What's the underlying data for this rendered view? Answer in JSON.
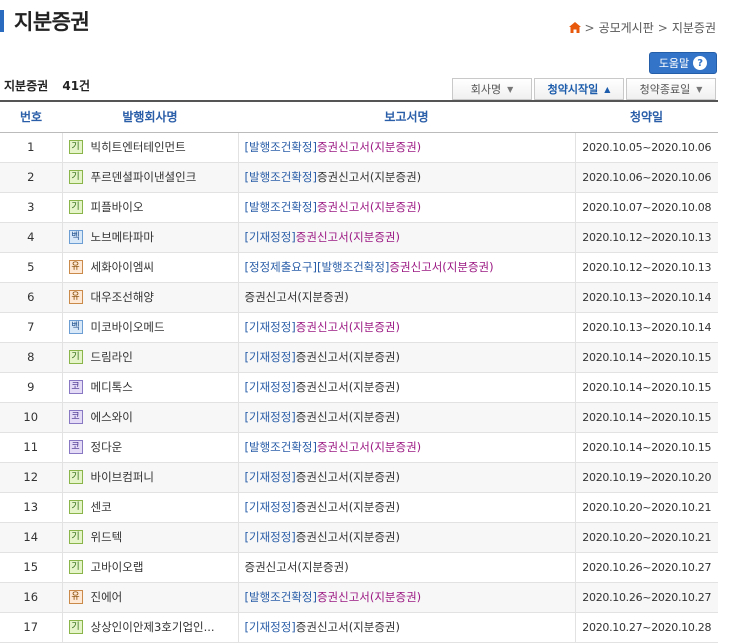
{
  "header": {
    "title": "지분증권",
    "breadcrumb": [
      "공모게시판",
      "지분증권"
    ]
  },
  "help_label": "도움말",
  "summary": {
    "label": "지분증권",
    "count": "41건"
  },
  "sort_buttons": [
    {
      "label": "회사명",
      "arrow": "▼",
      "active": false
    },
    {
      "label": "청약시작일",
      "arrow": "▲",
      "active": true
    },
    {
      "label": "청약종료일",
      "arrow": "▼",
      "active": false
    }
  ],
  "table": {
    "headers": [
      "번호",
      "발행회사명",
      "보고서명",
      "청약일"
    ],
    "rows": [
      {
        "no": "1",
        "market": "기",
        "company": "빅히트엔터테인먼트",
        "tag": "[발행조건확정]",
        "report": "증권신고서(지분증권)",
        "link": true,
        "period": "2020.10.05~2020.10.06"
      },
      {
        "no": "2",
        "market": "기",
        "company": "푸르덴셜파이낸셜인크",
        "tag": "[발행조건확정]",
        "report": "증권신고서(지분증권)",
        "link": false,
        "period": "2020.10.06~2020.10.06"
      },
      {
        "no": "3",
        "market": "기",
        "company": "피플바이오",
        "tag": "[발행조건확정]",
        "report": "증권신고서(지분증권)",
        "link": true,
        "period": "2020.10.07~2020.10.08"
      },
      {
        "no": "4",
        "market": "벡",
        "company": "노브메타파마",
        "tag": "[기재정정]",
        "report": "증권신고서(지분증권)",
        "link": true,
        "period": "2020.10.12~2020.10.13"
      },
      {
        "no": "5",
        "market": "유",
        "company": "세화아이엠씨",
        "tag": "[정정제출요구][발행조건확정]",
        "report": "증권신고서(지분증권)",
        "link": true,
        "period": "2020.10.12~2020.10.13"
      },
      {
        "no": "6",
        "market": "유",
        "company": "대우조선해양",
        "tag": "",
        "report": "증권신고서(지분증권)",
        "link": false,
        "period": "2020.10.13~2020.10.14"
      },
      {
        "no": "7",
        "market": "벡",
        "company": "미코바이오메드",
        "tag": "[기재정정]",
        "report": "증권신고서(지분증권)",
        "link": true,
        "period": "2020.10.13~2020.10.14"
      },
      {
        "no": "8",
        "market": "기",
        "company": "드림라인",
        "tag": "[기재정정]",
        "report": "증권신고서(지분증권)",
        "link": false,
        "period": "2020.10.14~2020.10.15"
      },
      {
        "no": "9",
        "market": "코",
        "company": "메디톡스",
        "tag": "[기재정정]",
        "report": "증권신고서(지분증권)",
        "link": false,
        "period": "2020.10.14~2020.10.15"
      },
      {
        "no": "10",
        "market": "코",
        "company": "에스와이",
        "tag": "[기재정정]",
        "report": "증권신고서(지분증권)",
        "link": false,
        "period": "2020.10.14~2020.10.15"
      },
      {
        "no": "11",
        "market": "코",
        "company": "정다운",
        "tag": "[발행조건확정]",
        "report": "증권신고서(지분증권)",
        "link": true,
        "period": "2020.10.14~2020.10.15"
      },
      {
        "no": "12",
        "market": "기",
        "company": "바이브컴퍼니",
        "tag": "[기재정정]",
        "report": "증권신고서(지분증권)",
        "link": false,
        "period": "2020.10.19~2020.10.20"
      },
      {
        "no": "13",
        "market": "기",
        "company": "센코",
        "tag": "[기재정정]",
        "report": "증권신고서(지분증권)",
        "link": false,
        "period": "2020.10.20~2020.10.21"
      },
      {
        "no": "14",
        "market": "기",
        "company": "위드텍",
        "tag": "[기재정정]",
        "report": "증권신고서(지분증권)",
        "link": false,
        "period": "2020.10.20~2020.10.21"
      },
      {
        "no": "15",
        "market": "기",
        "company": "고바이오랩",
        "tag": "",
        "report": "증권신고서(지분증권)",
        "link": false,
        "period": "2020.10.26~2020.10.27"
      },
      {
        "no": "16",
        "market": "유",
        "company": "진에어",
        "tag": "[발행조건확정]",
        "report": "증권신고서(지분증권)",
        "link": true,
        "period": "2020.10.26~2020.10.27"
      },
      {
        "no": "17",
        "market": "기",
        "company": "상상인이안제3호기업인...",
        "tag": "[기재정정]",
        "report": "증권신고서(지분증권)",
        "link": false,
        "period": "2020.10.27~2020.10.28"
      }
    ]
  }
}
